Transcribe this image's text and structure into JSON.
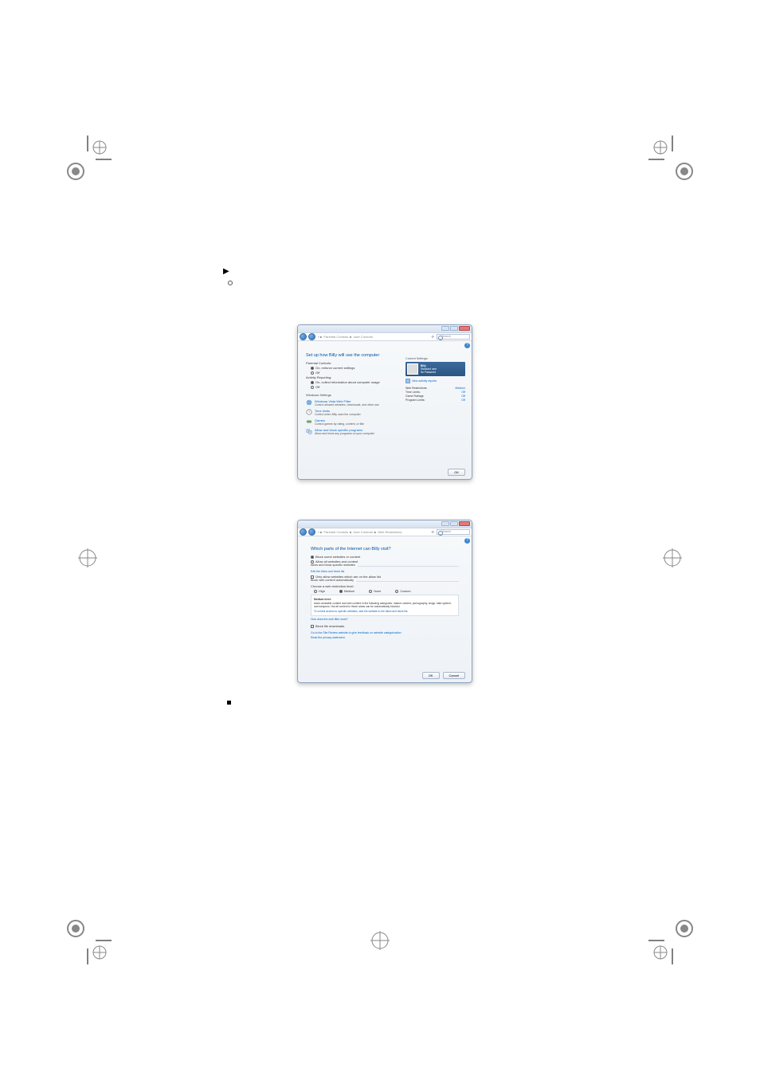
{
  "win1": {
    "breadcrumb": [
      "«",
      "Parental Controls",
      "User Controls"
    ],
    "search_placeholder": "Search",
    "heading": "Set up how Billy will use the computer",
    "pc_label": "Parental Controls:",
    "pc_on": "On, enforce current settings",
    "pc_off": "Off",
    "ar_label": "Activity Reporting:",
    "ar_on": "On, collect information about computer usage",
    "ar_off": "Off",
    "ws_label": "Windows Settings",
    "items": [
      {
        "title": "Windows Vista Web Filter",
        "desc": "Control allowed websites, downloads, and other use"
      },
      {
        "title": "Time limits",
        "desc": "Control when Billy uses the computer"
      },
      {
        "title": "Games",
        "desc": "Control games by rating, content, or title"
      },
      {
        "title": "Allow and block specific programs",
        "desc": "Allow and block any programs on your computer"
      }
    ],
    "current_label": "Current Settings:",
    "user_name": "Billy",
    "user_role": "Standard user",
    "user_pw": "No Password",
    "view_reports": "View activity reports",
    "stats": [
      {
        "k": "Web Restrictions:",
        "v": "Medium"
      },
      {
        "k": "Time Limits:",
        "v": "Off"
      },
      {
        "k": "Game Ratings:",
        "v": "Off"
      },
      {
        "k": "Program Limits:",
        "v": "Off"
      }
    ],
    "ok": "OK"
  },
  "win2": {
    "breadcrumb": [
      "«",
      "Parental Controls",
      "User Controls",
      "Web Restrictions"
    ],
    "search_placeholder": "Search",
    "heading": "Which parts of the Internet can Billy visit?",
    "opt_block": "Block some websites or content",
    "opt_allow": "Allow all websites and content",
    "allow_block_hdr": "Allow and block specific websites",
    "edit_list": "Edit the Allow and block list",
    "only_allow": "Only allow websites which are on the allow list",
    "auto_hdr": "Block web content automatically",
    "choose_level": "Choose a web restriction level:",
    "levels": {
      "high": "High",
      "medium": "Medium",
      "none": "None",
      "custom": "Custom"
    },
    "level_desc_title": "Medium level:",
    "level_desc": "block unratable content and web content in the following categories: mature content, pornography, drugs, hate speech, and weapons. Not all content in these areas can be automatically blocked.",
    "to_control": "To control access to specific websites, add the website to the Allow and block list.",
    "how_filter": "How does the web filter work?",
    "block_dl": "Block file downloads",
    "site_review": "Go to the Site Review website to give feedback on website categorization",
    "privacy": "Read the privacy statement.",
    "ok": "OK",
    "cancel": "Cancel"
  }
}
